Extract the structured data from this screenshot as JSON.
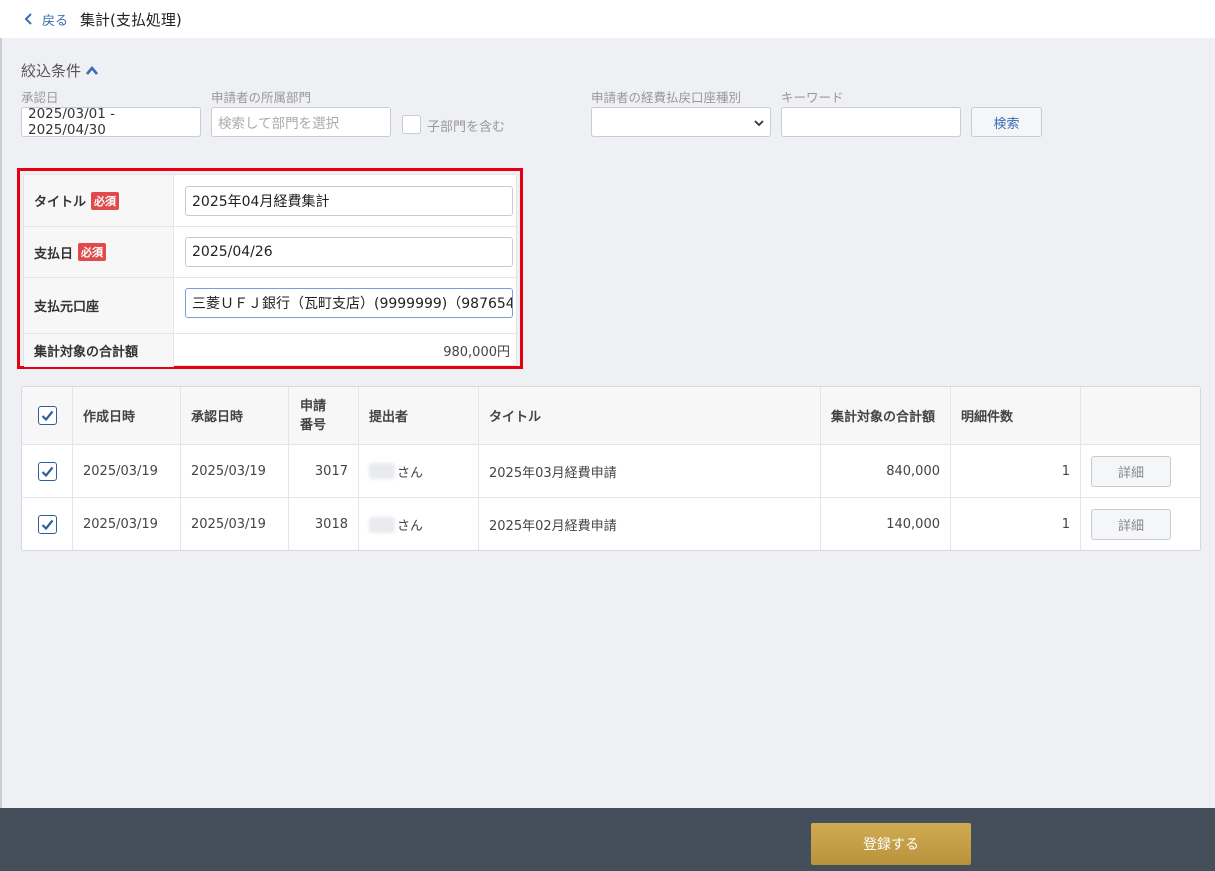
{
  "header": {
    "back_label": "戻る",
    "title": "集計(支払処理)"
  },
  "filters": {
    "heading": "絞込条件",
    "approval_date": {
      "label": "承認日",
      "value": "2025/03/01 - 2025/04/30"
    },
    "department": {
      "label": "申請者の所属部門",
      "placeholder": "検索して部門を選択"
    },
    "include_sub": {
      "label": "子部門を含む",
      "checked": false
    },
    "refund_account_type": {
      "label": "申請者の経費払戻口座種別",
      "value": ""
    },
    "keyword": {
      "label": "キーワード",
      "value": ""
    },
    "search_label": "検索"
  },
  "form": {
    "required_badge": "必須",
    "title": {
      "label": "タイトル",
      "value": "2025年04月経費集計"
    },
    "payment_date": {
      "label": "支払日",
      "value": "2025/04/26"
    },
    "source_account": {
      "label": "支払元口座",
      "value": "三菱ＵＦＪ銀行（瓦町支店）(9999999)（987654…"
    },
    "total": {
      "label": "集計対象の合計額",
      "value": "980,000円"
    }
  },
  "table": {
    "headers": {
      "created": "作成日時",
      "approved": "承認日時",
      "number": "申請番号",
      "submitter": "提出者",
      "title": "タイトル",
      "total": "集計対象の合計額",
      "count": "明細件数"
    },
    "header_checked": true,
    "rows": [
      {
        "checked": true,
        "created": "2025/03/19",
        "approved": "2025/03/19",
        "number": "3017",
        "submitter_suffix": "さん",
        "title": "2025年03月経費申請",
        "total": "840,000",
        "count": "1",
        "action": "詳細"
      },
      {
        "checked": true,
        "created": "2025/03/19",
        "approved": "2025/03/19",
        "number": "3018",
        "submitter_suffix": "さん",
        "title": "2025年02月経費申請",
        "total": "140,000",
        "count": "1",
        "action": "詳細"
      }
    ]
  },
  "footer": {
    "register_label": "登録する"
  },
  "colors": {
    "accent": "#3a6cb4",
    "highlight_border": "#e60012",
    "register_button": "#c4a047",
    "footer_bg": "#454e5b",
    "required_badge": "#e04a4a"
  }
}
